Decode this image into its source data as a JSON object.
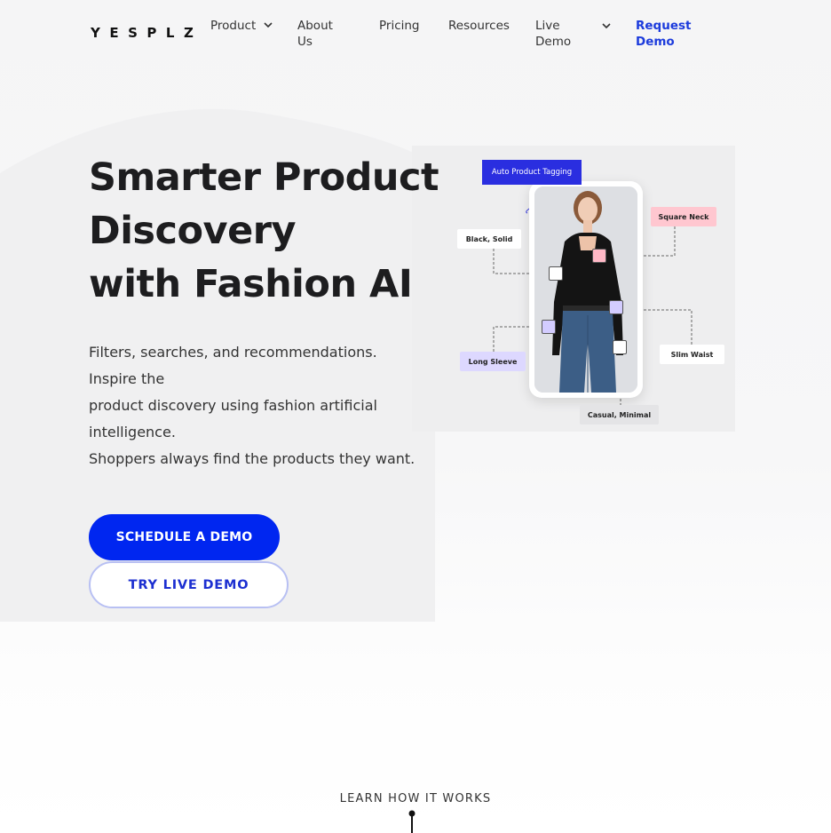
{
  "nav": {
    "logo": "YESPLZ",
    "items": [
      {
        "label": "Product",
        "icon": "chevron-down-icon"
      },
      {
        "label_lines": [
          "About",
          "Us"
        ]
      },
      {
        "label": "Pricing"
      },
      {
        "label": "Resources"
      },
      {
        "label_lines": [
          "Live",
          "Demo"
        ],
        "icon": "chevron-down-icon"
      },
      {
        "label_lines": [
          "Request",
          "Demo"
        ]
      }
    ]
  },
  "hero": {
    "title_lines": [
      "Smarter Product",
      "Discovery",
      "with Fashion AI"
    ],
    "description_lines": [
      "Filters, searches, and recommendations.",
      "Inspire the",
      "product discovery using fashion artificial",
      "intelligence.",
      "Shoppers always find the products they want."
    ],
    "primary_button": "SCHEDULE A DEMO",
    "secondary_button": "TRY LIVE DEMO"
  },
  "illustration": {
    "tags": {
      "auto": "Auto Product Tagging",
      "black_solid": "Black, Solid",
      "square_neck": "Square Neck",
      "long_sleeve": "Long Sleeve",
      "slim_waist": "Slim Waist",
      "casual_minimal": "Casual, Minimal"
    }
  },
  "footer": {
    "learn_label": "LEARN HOW IT WORKS",
    "arrow_icon": "arrow-down-icon"
  },
  "colors": {
    "accent": "#0026f0",
    "link": "#1c3bdc",
    "tag_pink": "#ffc7d0",
    "tag_purple": "#ddd8ff"
  }
}
